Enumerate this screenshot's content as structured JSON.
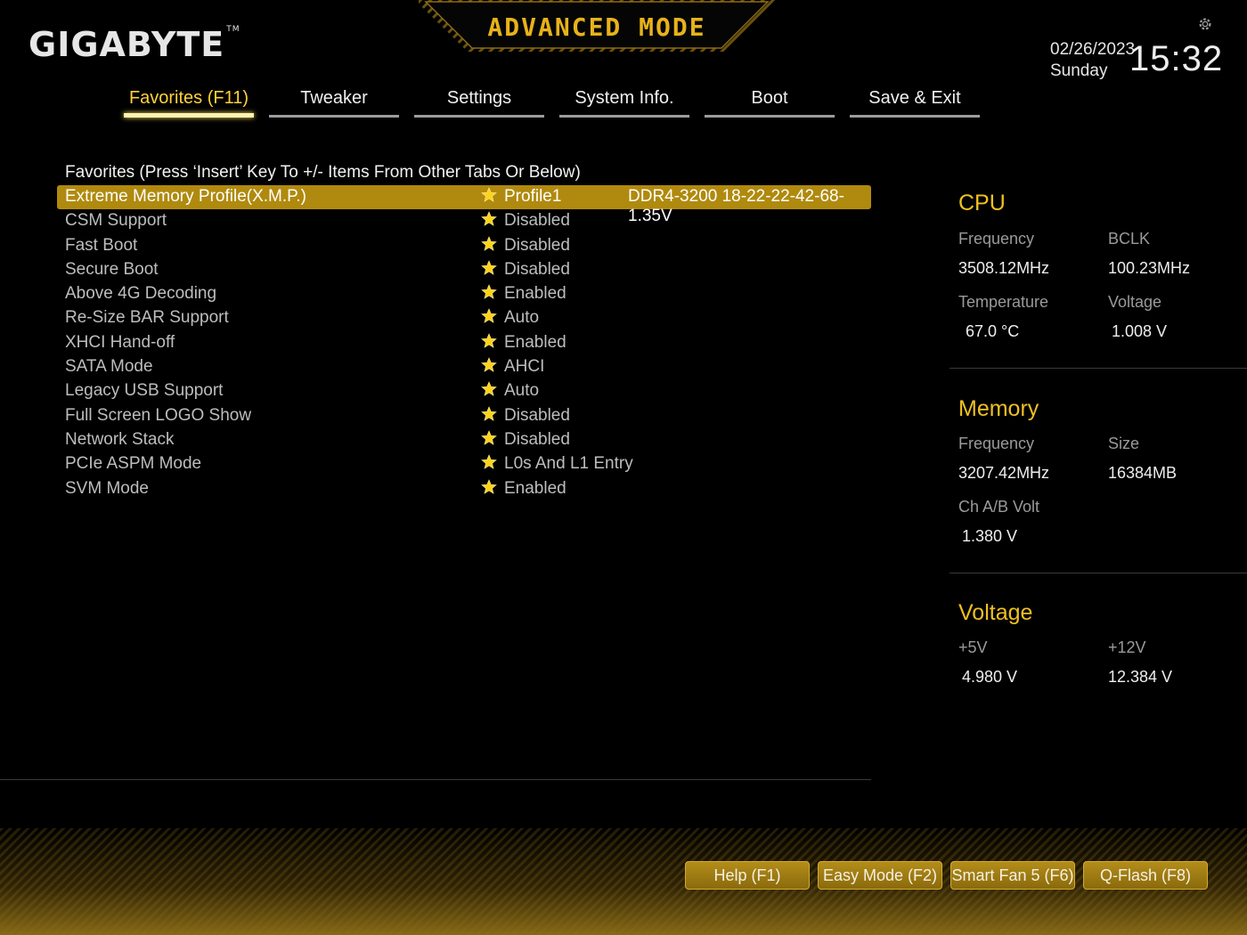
{
  "header": {
    "brand": "GIGABYTE",
    "trademark": "TM",
    "mode_title": "ADVANCED MODE",
    "date": "02/26/2023",
    "weekday": "Sunday",
    "time": "15:32",
    "settings_icon": "gear-icon"
  },
  "tabs": [
    {
      "label": "Favorites (F11)",
      "active": true
    },
    {
      "label": "Tweaker",
      "active": false
    },
    {
      "label": "Settings",
      "active": false
    },
    {
      "label": "System Info.",
      "active": false
    },
    {
      "label": "Boot",
      "active": false
    },
    {
      "label": "Save & Exit",
      "active": false
    }
  ],
  "favorites": {
    "header": "Favorites (Press ‘Insert’ Key To +/- Items From Other Tabs Or Below)",
    "items": [
      {
        "name": "Extreme Memory Profile(X.M.P.)",
        "value": "Profile1",
        "detail": "DDR4-3200 18-22-22-42-68-1.35V",
        "selected": true
      },
      {
        "name": "CSM Support",
        "value": "Disabled",
        "detail": ""
      },
      {
        "name": "Fast Boot",
        "value": "Disabled",
        "detail": ""
      },
      {
        "name": "Secure Boot",
        "value": "Disabled",
        "detail": ""
      },
      {
        "name": "Above 4G Decoding",
        "value": "Enabled",
        "detail": ""
      },
      {
        "name": "Re-Size BAR Support",
        "value": "Auto",
        "detail": ""
      },
      {
        "name": "XHCI Hand-off",
        "value": "Enabled",
        "detail": ""
      },
      {
        "name": "SATA Mode",
        "value": "AHCI",
        "detail": ""
      },
      {
        "name": "Legacy USB Support",
        "value": "Auto",
        "detail": ""
      },
      {
        "name": "Full Screen LOGO Show",
        "value": "Disabled",
        "detail": ""
      },
      {
        "name": "Network Stack",
        "value": "Disabled",
        "detail": ""
      },
      {
        "name": "PCIe ASPM Mode",
        "value": "L0s And L1 Entry",
        "detail": ""
      },
      {
        "name": "SVM Mode",
        "value": "Enabled",
        "detail": ""
      }
    ],
    "item_icon": "star-icon"
  },
  "monitor": {
    "cpu": {
      "title": "CPU",
      "frequency_label": "Frequency",
      "frequency": "3508.12MHz",
      "bclk_label": "BCLK",
      "bclk": "100.23MHz",
      "temperature_label": "Temperature",
      "temperature": "67.0 °C",
      "voltage_label": "Voltage",
      "voltage": "1.008 V"
    },
    "memory": {
      "title": "Memory",
      "frequency_label": "Frequency",
      "frequency": "3207.42MHz",
      "size_label": "Size",
      "size": "16384MB",
      "volt_label": "Ch A/B Volt",
      "volt": "1.380 V"
    },
    "voltage": {
      "title": "Voltage",
      "v5_label": "+5V",
      "v5": "4.980 V",
      "v12_label": "+12V",
      "v12": "12.384 V"
    }
  },
  "footer": {
    "buttons": [
      "Help (F1)",
      "Easy Mode (F2)",
      "Smart Fan 5 (F6)",
      "Q-Flash (F8)"
    ]
  },
  "colors": {
    "accent": "#e8b21a",
    "selected_row": "#b08a0e",
    "background": "#000000"
  }
}
